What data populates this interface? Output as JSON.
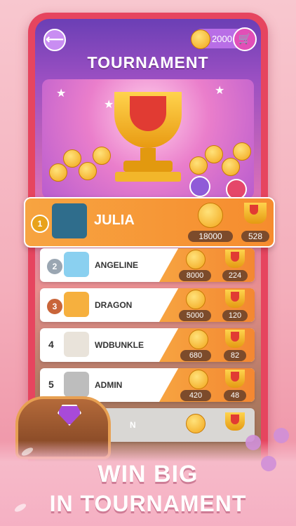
{
  "header": {
    "coins_amount": "2000",
    "title": "TOURNAMENT"
  },
  "leader": {
    "rank": "1",
    "name": "JULIA",
    "coins": "18000",
    "trophies": "528"
  },
  "rows": [
    {
      "rank": "2",
      "name": "ANGELINE",
      "coins": "8000",
      "trophies": "224"
    },
    {
      "rank": "3",
      "name": "DRAGON",
      "coins": "5000",
      "trophies": "120"
    },
    {
      "rank": "4",
      "name": "WDBUNKLE",
      "coins": "680",
      "trophies": "82"
    },
    {
      "rank": "5",
      "name": "ADMIN",
      "coins": "420",
      "trophies": "48"
    },
    {
      "rank": "",
      "name": "N",
      "coins": "",
      "trophies": ""
    }
  ],
  "tagline": {
    "line1": "WIN BIG",
    "line2": "IN TOURNAMENT"
  },
  "colors": {
    "accent_orange": "#f68c2e",
    "phone_frame": "#e6455f",
    "gold": "#f2a51b"
  }
}
